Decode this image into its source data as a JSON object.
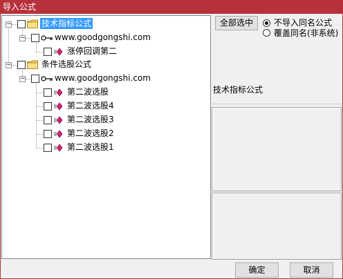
{
  "window": {
    "title": "导入公式"
  },
  "tree": {
    "groups": [
      {
        "label": "技术指标公式",
        "sites": [
          {
            "label": "www.goodgongshi.com",
            "formulas": [
              "涨停回调第二"
            ]
          }
        ]
      },
      {
        "label": "条件选股公式",
        "sites": [
          {
            "label": "www.goodgongshi.com",
            "formulas": [
              "第二波选股",
              "第二波选股4",
              "第二波选股3",
              "第二波选股2",
              "第二波选股1"
            ]
          }
        ]
      }
    ],
    "expander_symbol": "−"
  },
  "options": {
    "select_all_label": "全部选中",
    "radio_no_import_label": "不导入同名公式",
    "radio_overwrite_label": "覆盖同名(非系统)",
    "selected_radio": "no_import"
  },
  "info": {
    "type_label": "技术指标公式"
  },
  "footer": {
    "ok_label": "确定",
    "cancel_label": "取消"
  },
  "colors": {
    "titlebar": "#b7313c",
    "selection": "#3399ff",
    "formula_icon": "#d4237a",
    "folder": "#f3d46b"
  }
}
